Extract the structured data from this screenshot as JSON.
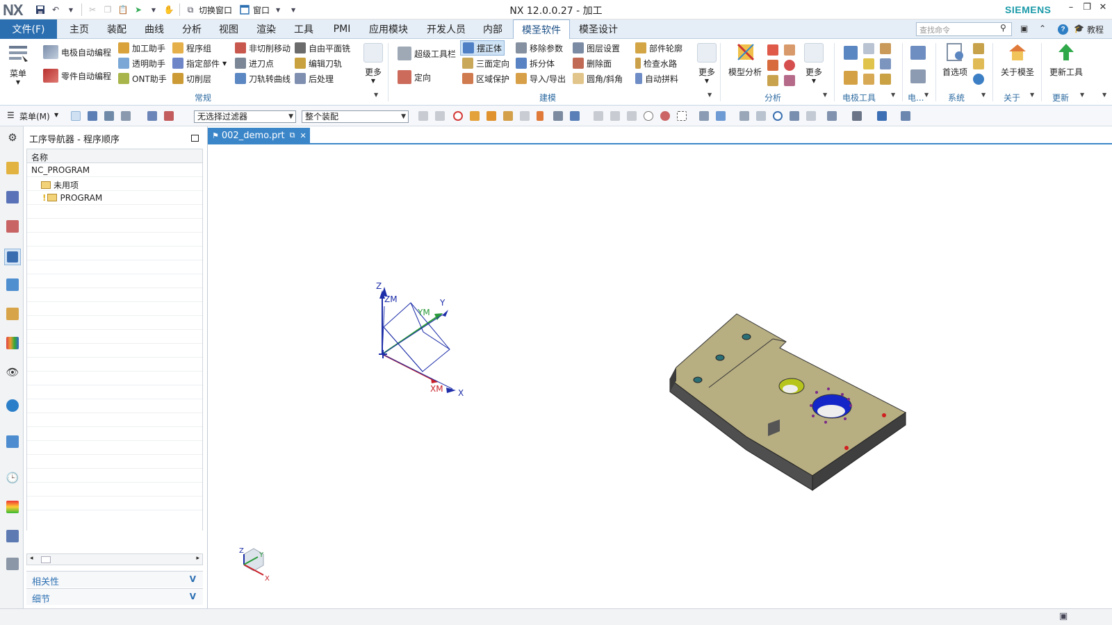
{
  "app": {
    "logo": "NX",
    "title": "NX 12.0.0.27 - 加工",
    "brand": "SIEMENS",
    "switch_window": "切换窗口",
    "window_menu": "窗口"
  },
  "menu": {
    "file": "文件(F)",
    "tabs": [
      "主页",
      "装配",
      "曲线",
      "分析",
      "视图",
      "渲染",
      "工具",
      "PMI",
      "应用模块",
      "开发人员",
      "内部",
      "模圣软件",
      "模圣设计"
    ],
    "active_tab": "模圣软件",
    "search_placeholder": "查找命令",
    "tutorial": "教程"
  },
  "ribbon": {
    "menu_big": "菜单",
    "electrode_prog": "电极自动编程",
    "part_prog": "零件自动编程",
    "machining_helper": "加工助手",
    "transparent_helper": "透明助手",
    "ont_helper": "ONT助手",
    "program_group": "程序组",
    "assign_parts": "指定部件",
    "cut_layers": "切削层",
    "non_cut_move": "非切削移动",
    "entry_point": "进刀点",
    "toolpath_to_curve": "刀轨转曲线",
    "free_plane_mill": "自由平面铣",
    "edit_toolpath": "编辑刀轨",
    "post_process": "后处理",
    "more": "更多",
    "super_toolbar": "超级工具栏",
    "orient": "定向",
    "place_body": "摆正体",
    "three_face_orient": "三面定向",
    "region_protect": "区域保护",
    "remove_params": "移除参数",
    "split_body": "拆分体",
    "import_export": "导入/导出",
    "layer_settings": "图层设置",
    "delete_face": "删除面",
    "fillet_chamfer": "圆角/斜角",
    "part_outline": "部件轮廓",
    "check_waterway": "检查水路",
    "auto_assemble": "自动拼料",
    "model_analysis": "模型分析",
    "preferences": "首选项",
    "about": "关于模圣",
    "update_tools": "更新工具",
    "groups": {
      "general": "常规",
      "modeling": "建模",
      "analysis": "分析",
      "electrode_tools": "电极工具",
      "electrode_short": "电...",
      "system": "系统",
      "about": "关于",
      "update": "更新"
    }
  },
  "toolbar2": {
    "menu": "菜单(M)",
    "filter": "无选择过滤器",
    "scope": "整个装配"
  },
  "navigator": {
    "title": "工序导航器 - 程序顺序",
    "column": "名称",
    "rows": [
      "NC_PROGRAM",
      "未用项",
      "PROGRAM"
    ],
    "dependencies": "相关性",
    "details": "细节"
  },
  "graphics": {
    "tab": "002_demo.prt",
    "axes": {
      "x": "X",
      "y": "Y",
      "z": "Z",
      "xm": "XM",
      "ym": "YM",
      "zm": "ZM"
    }
  },
  "colors": {
    "accent": "#2b6fb1",
    "brand": "#1a9aa8",
    "part_top": "#b7ae82",
    "part_side": "#4f4f4f",
    "hole_blue": "#1426c8",
    "hole_yellow": "#b7c41c"
  }
}
